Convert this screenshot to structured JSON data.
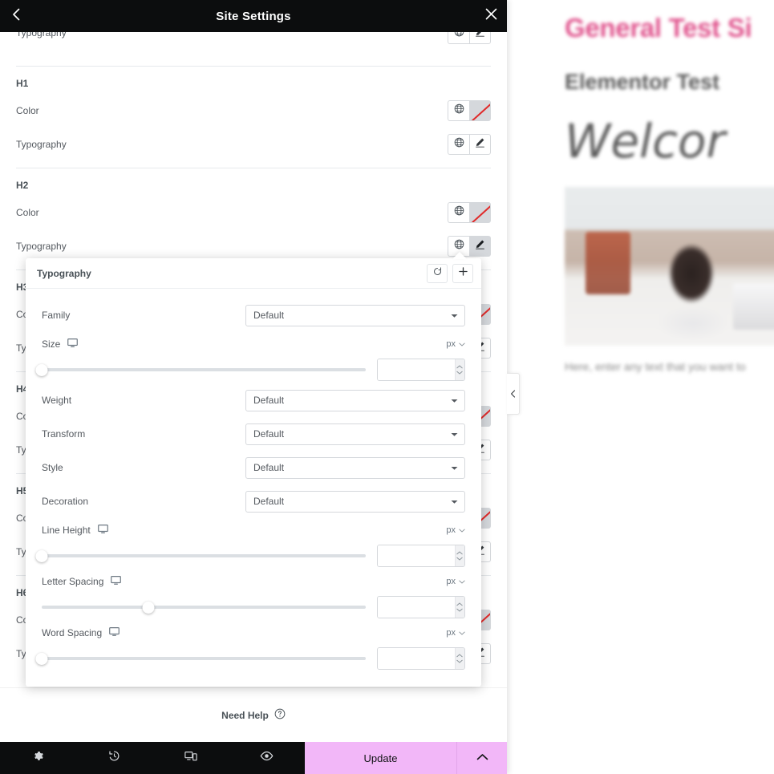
{
  "header": {
    "title": "Site Settings",
    "back_icon": "chevron-left-icon",
    "close_icon": "close-icon"
  },
  "panel": {
    "top_partial_row": {
      "label": "Typography",
      "globe_icon": "globe-icon",
      "edit_icon": "pencil-icon"
    },
    "sections": [
      {
        "title": "H1",
        "rows": [
          {
            "label": "Color",
            "control": "color",
            "globe_icon": "globe-icon",
            "swatch_state": "none"
          },
          {
            "label": "Typography",
            "control": "typography",
            "globe_icon": "globe-icon",
            "edit_icon": "pencil-icon",
            "active": false
          }
        ]
      },
      {
        "title": "H2",
        "rows": [
          {
            "label": "Color",
            "control": "color",
            "globe_icon": "globe-icon",
            "swatch_state": "none"
          },
          {
            "label": "Typography",
            "control": "typography",
            "globe_icon": "globe-icon",
            "edit_icon": "pencil-icon",
            "active": true
          }
        ]
      },
      {
        "title": "H3",
        "rows": [
          {
            "label": "Color",
            "control": "color",
            "globe_icon": "globe-icon",
            "swatch_state": "none"
          },
          {
            "label": "Typography",
            "control": "typography",
            "globe_icon": "globe-icon",
            "edit_icon": "pencil-icon",
            "active": false
          }
        ]
      },
      {
        "title": "H4",
        "rows": [
          {
            "label": "Color",
            "control": "color",
            "globe_icon": "globe-icon",
            "swatch_state": "none"
          },
          {
            "label": "Typography",
            "control": "typography",
            "globe_icon": "globe-icon",
            "edit_icon": "pencil-icon",
            "active": false
          }
        ]
      },
      {
        "title": "H5",
        "rows": [
          {
            "label": "Color",
            "control": "color",
            "globe_icon": "globe-icon",
            "swatch_state": "none"
          },
          {
            "label": "Typography",
            "control": "typography",
            "globe_icon": "globe-icon",
            "edit_icon": "pencil-icon",
            "active": false
          }
        ]
      },
      {
        "title": "H6",
        "rows": [
          {
            "label": "Color",
            "control": "color",
            "globe_icon": "globe-icon",
            "swatch_state": "none"
          },
          {
            "label": "Typography",
            "control": "typography",
            "globe_icon": "globe-icon",
            "edit_icon": "pencil-icon",
            "active": false
          }
        ]
      }
    ]
  },
  "popover": {
    "title": "Typography",
    "reset_icon": "reset-icon",
    "add_icon": "plus-icon",
    "fields": {
      "family": {
        "label": "Family",
        "value": "Default",
        "caret_icon": "chevron-down-icon"
      },
      "size": {
        "label": "Size",
        "device_icon": "desktop-icon",
        "unit": "px",
        "unit_caret_icon": "chevron-down-icon",
        "value": "",
        "slider_percent": 0
      },
      "weight": {
        "label": "Weight",
        "value": "Default",
        "caret_icon": "chevron-down-icon"
      },
      "transform": {
        "label": "Transform",
        "value": "Default",
        "caret_icon": "chevron-down-icon"
      },
      "style": {
        "label": "Style",
        "value": "Default",
        "caret_icon": "chevron-down-icon"
      },
      "decoration": {
        "label": "Decoration",
        "value": "Default",
        "caret_icon": "chevron-down-icon"
      },
      "line_height": {
        "label": "Line Height",
        "device_icon": "desktop-icon",
        "unit": "px",
        "unit_caret_icon": "chevron-down-icon",
        "value": "",
        "slider_percent": 0
      },
      "letter_spacing": {
        "label": "Letter Spacing",
        "device_icon": "desktop-icon",
        "unit": "px",
        "unit_caret_icon": "chevron-down-icon",
        "value": "",
        "slider_percent": 33
      },
      "word_spacing": {
        "label": "Word Spacing",
        "device_icon": "desktop-icon",
        "unit": "px",
        "unit_caret_icon": "chevron-down-icon",
        "value": "",
        "slider_percent": 0
      }
    }
  },
  "footer": {
    "need_help": {
      "label": "Need Help",
      "icon": "question-circle-icon"
    },
    "tools": [
      {
        "name": "settings",
        "icon": "gear-icon"
      },
      {
        "name": "history",
        "icon": "history-icon"
      },
      {
        "name": "responsive-mode",
        "icon": "responsive-icon"
      },
      {
        "name": "preview",
        "icon": "eye-icon"
      }
    ],
    "update_label": "Update",
    "update_caret_icon": "chevron-up-icon",
    "update_color": "#f2b7f8"
  },
  "preview": {
    "site_title": "General Test Si",
    "site_subtitle": "Elementor Test",
    "heading": "Welcor",
    "caption": "Here, enter any text that you want to",
    "title_color": "#e0558e",
    "collapse_icon": "chevron-left-icon"
  }
}
